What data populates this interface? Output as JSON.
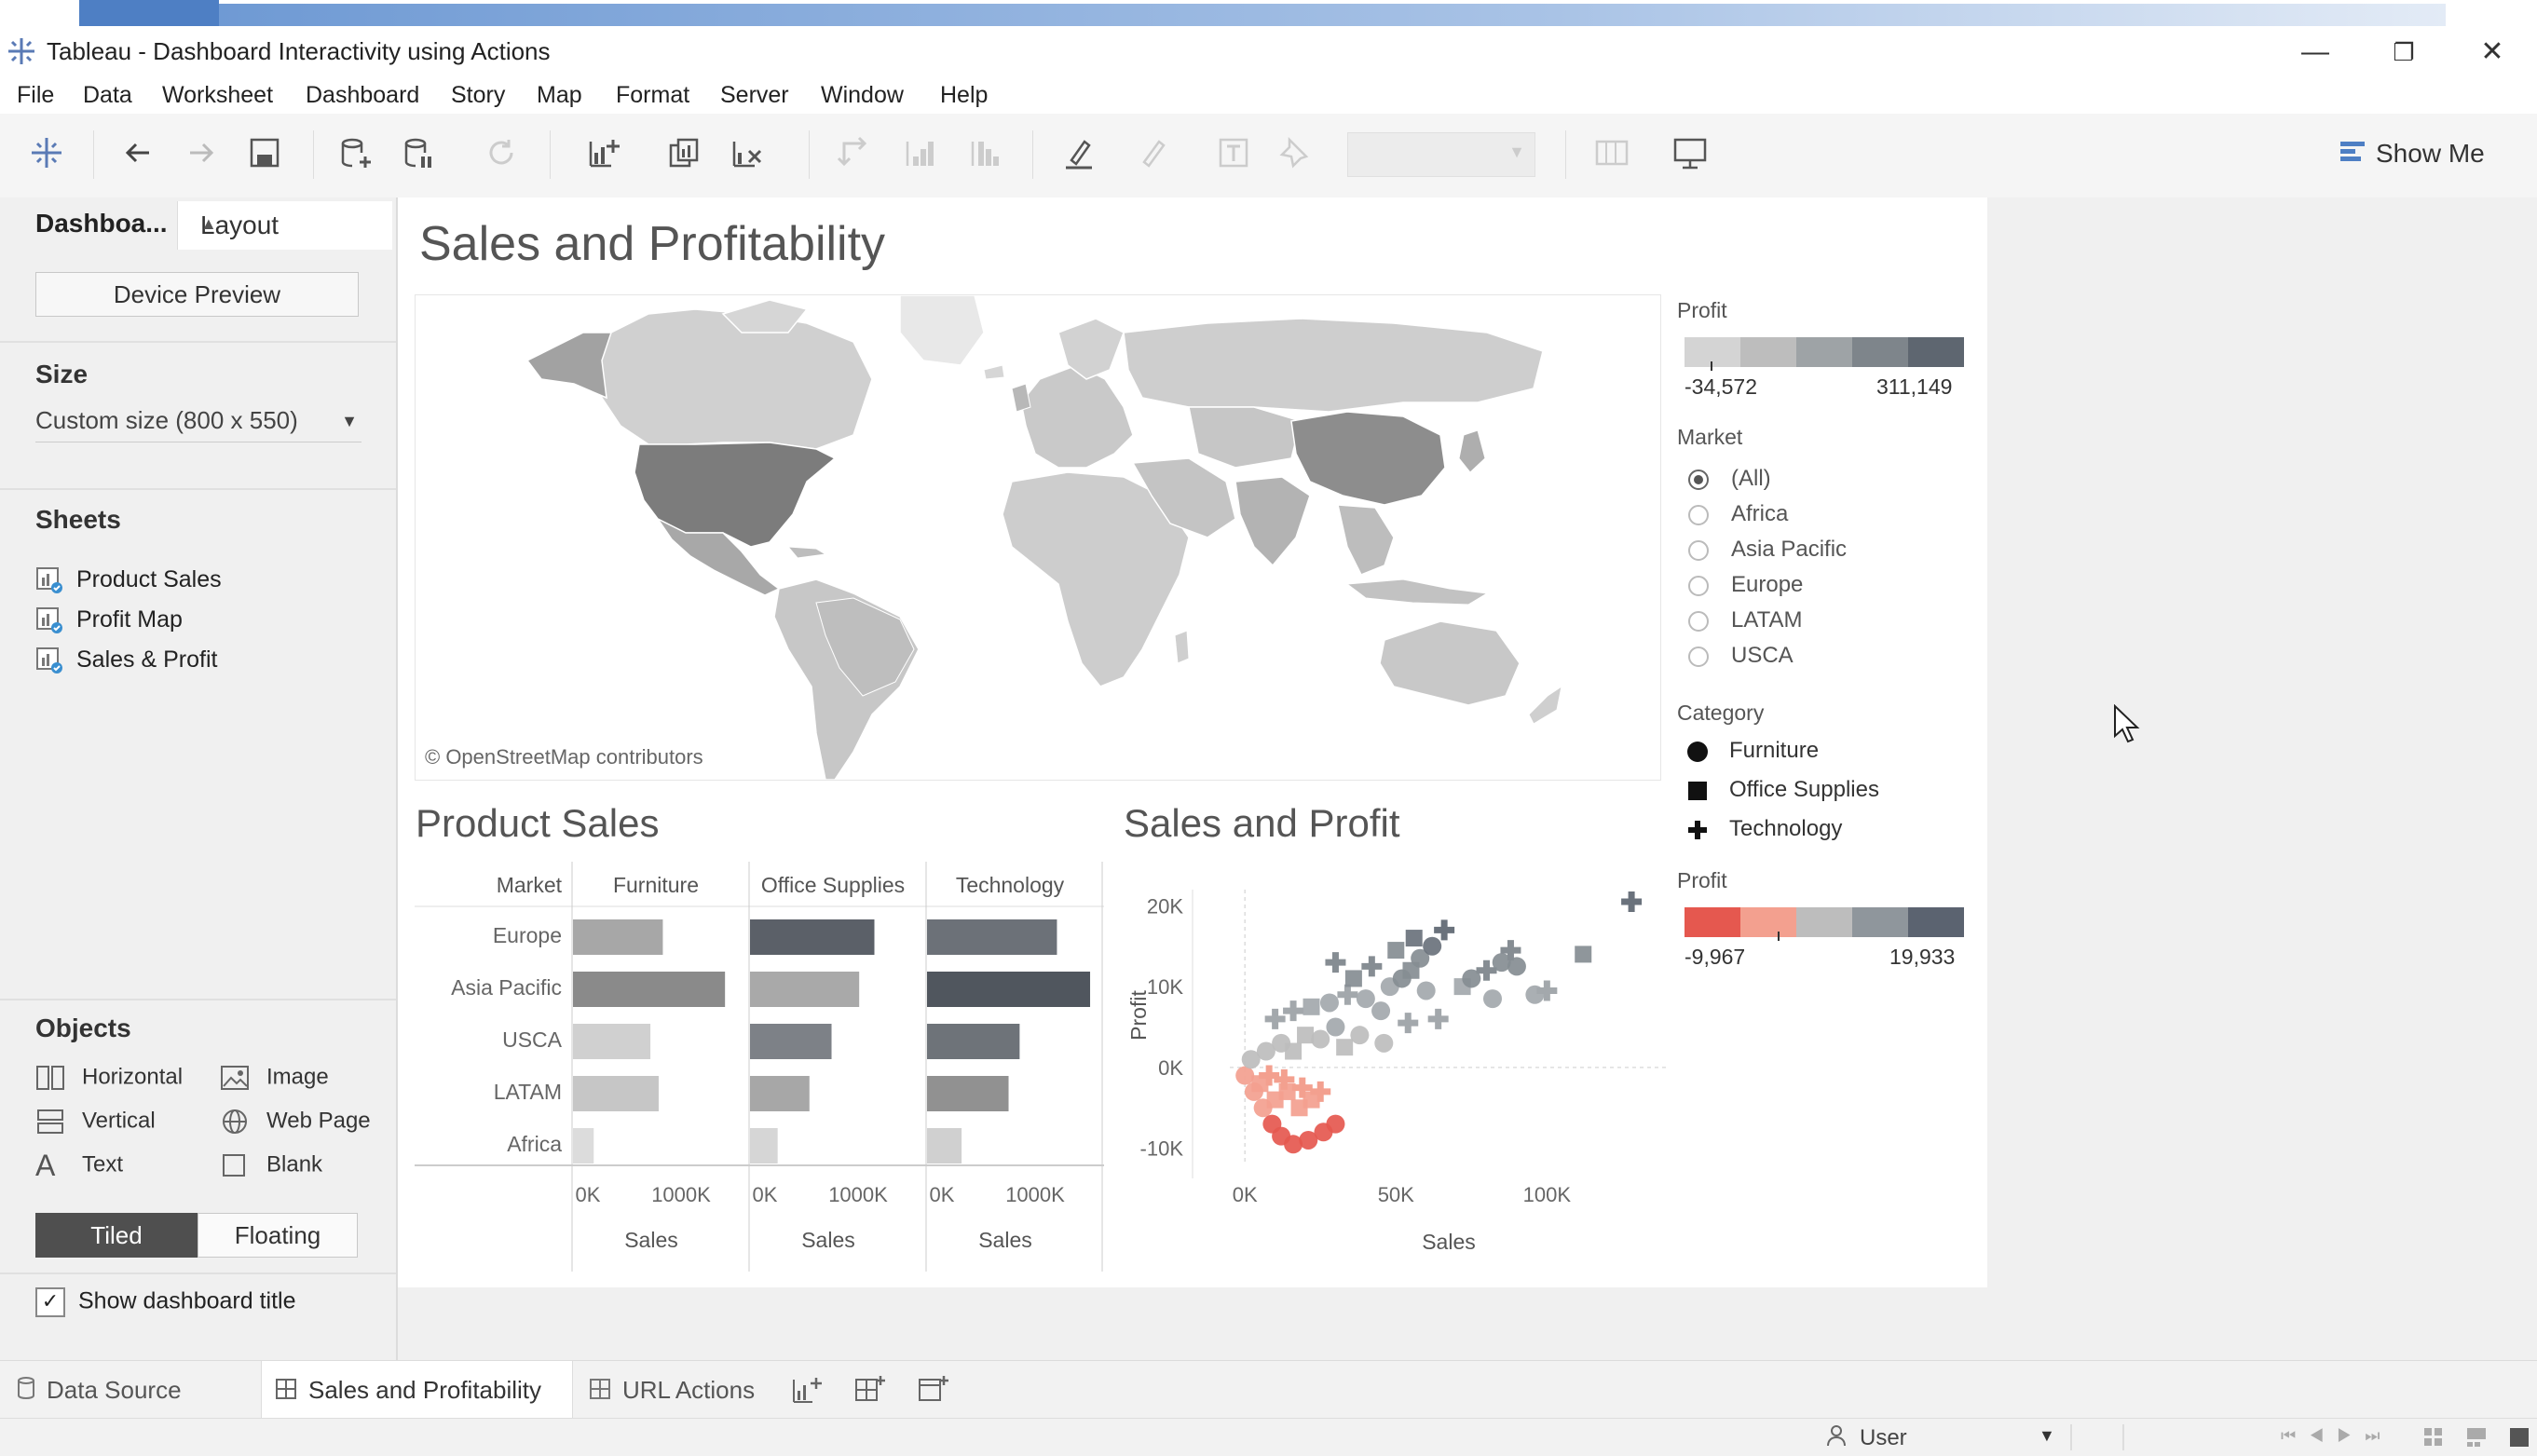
{
  "window": {
    "title": "Tableau - Dashboard Interactivity using Actions",
    "controls": [
      "minimize",
      "restore",
      "close"
    ]
  },
  "menu": [
    "File",
    "Data",
    "Worksheet",
    "Dashboard",
    "Story",
    "Map",
    "Format",
    "Server",
    "Window",
    "Help"
  ],
  "toolbar": {
    "show_me": "Show Me"
  },
  "left_panel": {
    "tab_dashboard": "Dashboa...",
    "tab_layout": "Layout",
    "device_preview": "Device Preview",
    "size_heading": "Size",
    "size_value": "Custom size (800 x 550)",
    "sheets_heading": "Sheets",
    "sheets": [
      "Product Sales",
      "Profit Map",
      "Sales & Profit"
    ],
    "objects_heading": "Objects",
    "objects": {
      "horizontal": "Horizontal",
      "vertical": "Vertical",
      "text": "Text",
      "image": "Image",
      "web_page": "Web Page",
      "blank": "Blank"
    },
    "tiled": "Tiled",
    "floating": "Floating",
    "show_title": "Show dashboard title",
    "show_title_checked": true
  },
  "dashboard": {
    "title": "Sales and Profitability",
    "map_credit": "© OpenStreetMap contributors",
    "product_sales_title": "Product Sales",
    "sales_profit_title": "Sales and Profit"
  },
  "legends": {
    "profit1": {
      "title": "Profit",
      "min": "-34,572",
      "max": "311,149",
      "colors": [
        "#d4d4d4",
        "#bdbdbd",
        "#9ea3a6",
        "#7e858b",
        "#5e6670"
      ]
    },
    "market": {
      "title": "Market",
      "options": [
        "(All)",
        "Africa",
        "Asia Pacific",
        "Europe",
        "LATAM",
        "USCA"
      ],
      "selected": "(All)"
    },
    "category": {
      "title": "Category",
      "items": [
        "Furniture",
        "Office Supplies",
        "Technology"
      ],
      "symbols": [
        "circle",
        "square",
        "cross"
      ]
    },
    "profit2": {
      "title": "Profit",
      "min": "-9,967",
      "max": "19,933",
      "colors": [
        "#e5584f",
        "#f3a08f",
        "#bdbdbd",
        "#8f969c",
        "#5b6370"
      ]
    }
  },
  "chart_data": [
    {
      "type": "bar",
      "title": "Product Sales",
      "row_header": "Market",
      "categories": [
        "Europe",
        "Asia Pacific",
        "USCA",
        "LATAM",
        "Africa"
      ],
      "series": [
        {
          "name": "Furniture",
          "values": [
            650000,
            1100000,
            560000,
            620000,
            150000
          ]
        },
        {
          "name": "Office Supplies",
          "values": [
            900000,
            790000,
            590000,
            430000,
            200000
          ]
        },
        {
          "name": "Technology",
          "values": [
            940000,
            1180000,
            670000,
            590000,
            250000
          ]
        }
      ],
      "tick_labels": [
        "0K",
        "1000K"
      ],
      "xlabel": "Sales",
      "xlim": [
        0,
        1200000
      ]
    },
    {
      "type": "scatter",
      "title": "Sales and Profit",
      "xlabel": "Sales",
      "ylabel": "Profit",
      "x_ticks": [
        "0K",
        "50K",
        "100K"
      ],
      "y_ticks": [
        "20K",
        "10K",
        "0K",
        "-10K"
      ],
      "xlim": [
        -5000,
        140000
      ],
      "ylim": [
        -12000,
        22000
      ],
      "points": [
        {
          "x": 0,
          "y": -1000,
          "c": "circle"
        },
        {
          "x": 3000,
          "y": -3000,
          "c": "circle"
        },
        {
          "x": 6000,
          "y": -5000,
          "c": "circle"
        },
        {
          "x": 9000,
          "y": -7000,
          "c": "circle"
        },
        {
          "x": 12000,
          "y": -8500,
          "c": "circle"
        },
        {
          "x": 16000,
          "y": -9500,
          "c": "circle"
        },
        {
          "x": 21000,
          "y": -9000,
          "c": "circle"
        },
        {
          "x": 26000,
          "y": -8000,
          "c": "circle"
        },
        {
          "x": 30000,
          "y": -7000,
          "c": "circle"
        },
        {
          "x": 5000,
          "y": -2000,
          "c": "square"
        },
        {
          "x": 10000,
          "y": -4000,
          "c": "square"
        },
        {
          "x": 14000,
          "y": -3000,
          "c": "square"
        },
        {
          "x": 18000,
          "y": -5000,
          "c": "square"
        },
        {
          "x": 22000,
          "y": -4000,
          "c": "square"
        },
        {
          "x": 8000,
          "y": -1000,
          "c": "cross"
        },
        {
          "x": 13000,
          "y": -1500,
          "c": "cross"
        },
        {
          "x": 19000,
          "y": -2500,
          "c": "cross"
        },
        {
          "x": 25000,
          "y": -3000,
          "c": "cross"
        },
        {
          "x": 2000,
          "y": 1000,
          "c": "circle"
        },
        {
          "x": 7000,
          "y": 2000,
          "c": "circle"
        },
        {
          "x": 12000,
          "y": 3000,
          "c": "circle"
        },
        {
          "x": 16000,
          "y": 2000,
          "c": "square"
        },
        {
          "x": 20000,
          "y": 4000,
          "c": "square"
        },
        {
          "x": 25000,
          "y": 3500,
          "c": "circle"
        },
        {
          "x": 30000,
          "y": 5000,
          "c": "circle"
        },
        {
          "x": 33000,
          "y": 2500,
          "c": "square"
        },
        {
          "x": 38000,
          "y": 4000,
          "c": "circle"
        },
        {
          "x": 10000,
          "y": 6000,
          "c": "cross"
        },
        {
          "x": 16000,
          "y": 7000,
          "c": "cross"
        },
        {
          "x": 22000,
          "y": 7500,
          "c": "square"
        },
        {
          "x": 28000,
          "y": 8000,
          "c": "circle"
        },
        {
          "x": 34000,
          "y": 9000,
          "c": "cross"
        },
        {
          "x": 40000,
          "y": 8500,
          "c": "circle"
        },
        {
          "x": 45000,
          "y": 7000,
          "c": "circle"
        },
        {
          "x": 48000,
          "y": 10000,
          "c": "circle"
        },
        {
          "x": 52000,
          "y": 11000,
          "c": "circle"
        },
        {
          "x": 55000,
          "y": 12000,
          "c": "square"
        },
        {
          "x": 58000,
          "y": 13500,
          "c": "circle"
        },
        {
          "x": 60000,
          "y": 9500,
          "c": "circle"
        },
        {
          "x": 62000,
          "y": 15000,
          "c": "circle"
        },
        {
          "x": 66000,
          "y": 17000,
          "c": "cross"
        },
        {
          "x": 42000,
          "y": 12500,
          "c": "cross"
        },
        {
          "x": 36000,
          "y": 11000,
          "c": "square"
        },
        {
          "x": 30000,
          "y": 13000,
          "c": "cross"
        },
        {
          "x": 50000,
          "y": 14500,
          "c": "square"
        },
        {
          "x": 56000,
          "y": 16000,
          "c": "square"
        },
        {
          "x": 72000,
          "y": 10000,
          "c": "square"
        },
        {
          "x": 75000,
          "y": 11000,
          "c": "circle"
        },
        {
          "x": 80000,
          "y": 12000,
          "c": "cross"
        },
        {
          "x": 85000,
          "y": 13000,
          "c": "circle"
        },
        {
          "x": 88000,
          "y": 14500,
          "c": "cross"
        },
        {
          "x": 90000,
          "y": 12500,
          "c": "circle"
        },
        {
          "x": 82000,
          "y": 8500,
          "c": "circle"
        },
        {
          "x": 96000,
          "y": 9000,
          "c": "circle"
        },
        {
          "x": 100000,
          "y": 9500,
          "c": "cross"
        },
        {
          "x": 112000,
          "y": 14000,
          "c": "square"
        },
        {
          "x": 64000,
          "y": 6000,
          "c": "cross"
        },
        {
          "x": 54000,
          "y": 5500,
          "c": "cross"
        },
        {
          "x": 46000,
          "y": 3000,
          "c": "circle"
        },
        {
          "x": 128000,
          "y": 20500,
          "c": "cross"
        }
      ]
    }
  ],
  "sheet_tabs": {
    "data_source": "Data Source",
    "sales_profitability": "Sales and Profitability",
    "url_actions": "URL Actions"
  },
  "status": {
    "user": "User"
  }
}
